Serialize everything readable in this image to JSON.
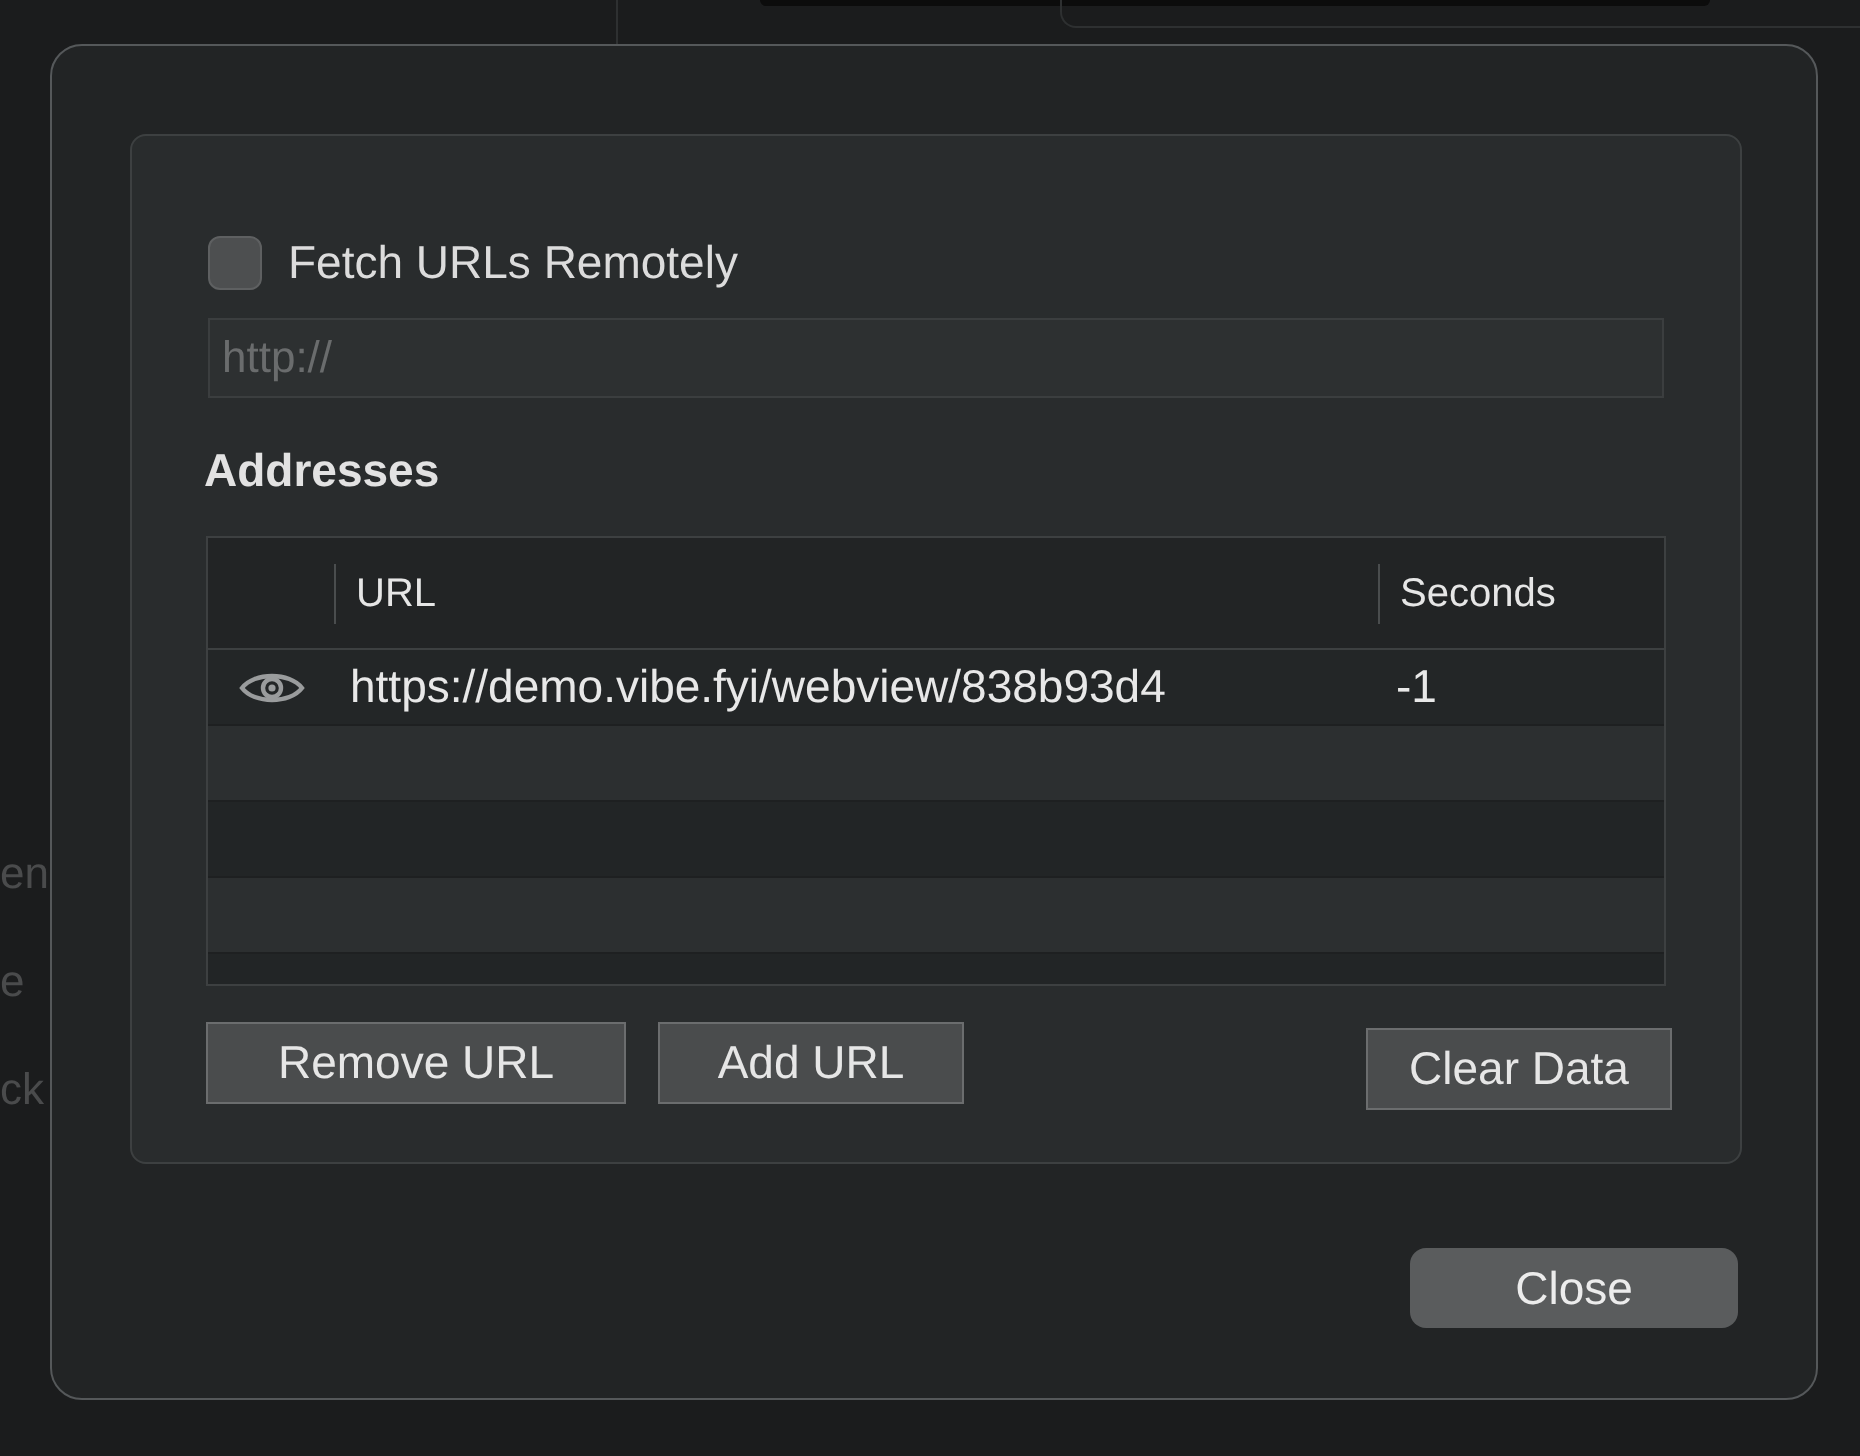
{
  "background_fragments": [
    "en",
    "e",
    "ck"
  ],
  "dialog": {
    "fetch_remotely": {
      "label": "Fetch URLs Remotely",
      "checked": false
    },
    "url_field": {
      "placeholder": "http://"
    },
    "addresses": {
      "title": "Addresses",
      "columns": [
        "URL",
        "Seconds"
      ],
      "rows": [
        {
          "url": "https://demo.vibe.fyi/webview/838b93d4",
          "seconds": "-1"
        }
      ]
    },
    "buttons": [
      "Remove URL",
      "Add URL"
    ],
    "clear_button": "Clear Data",
    "close_button": "Close"
  }
}
